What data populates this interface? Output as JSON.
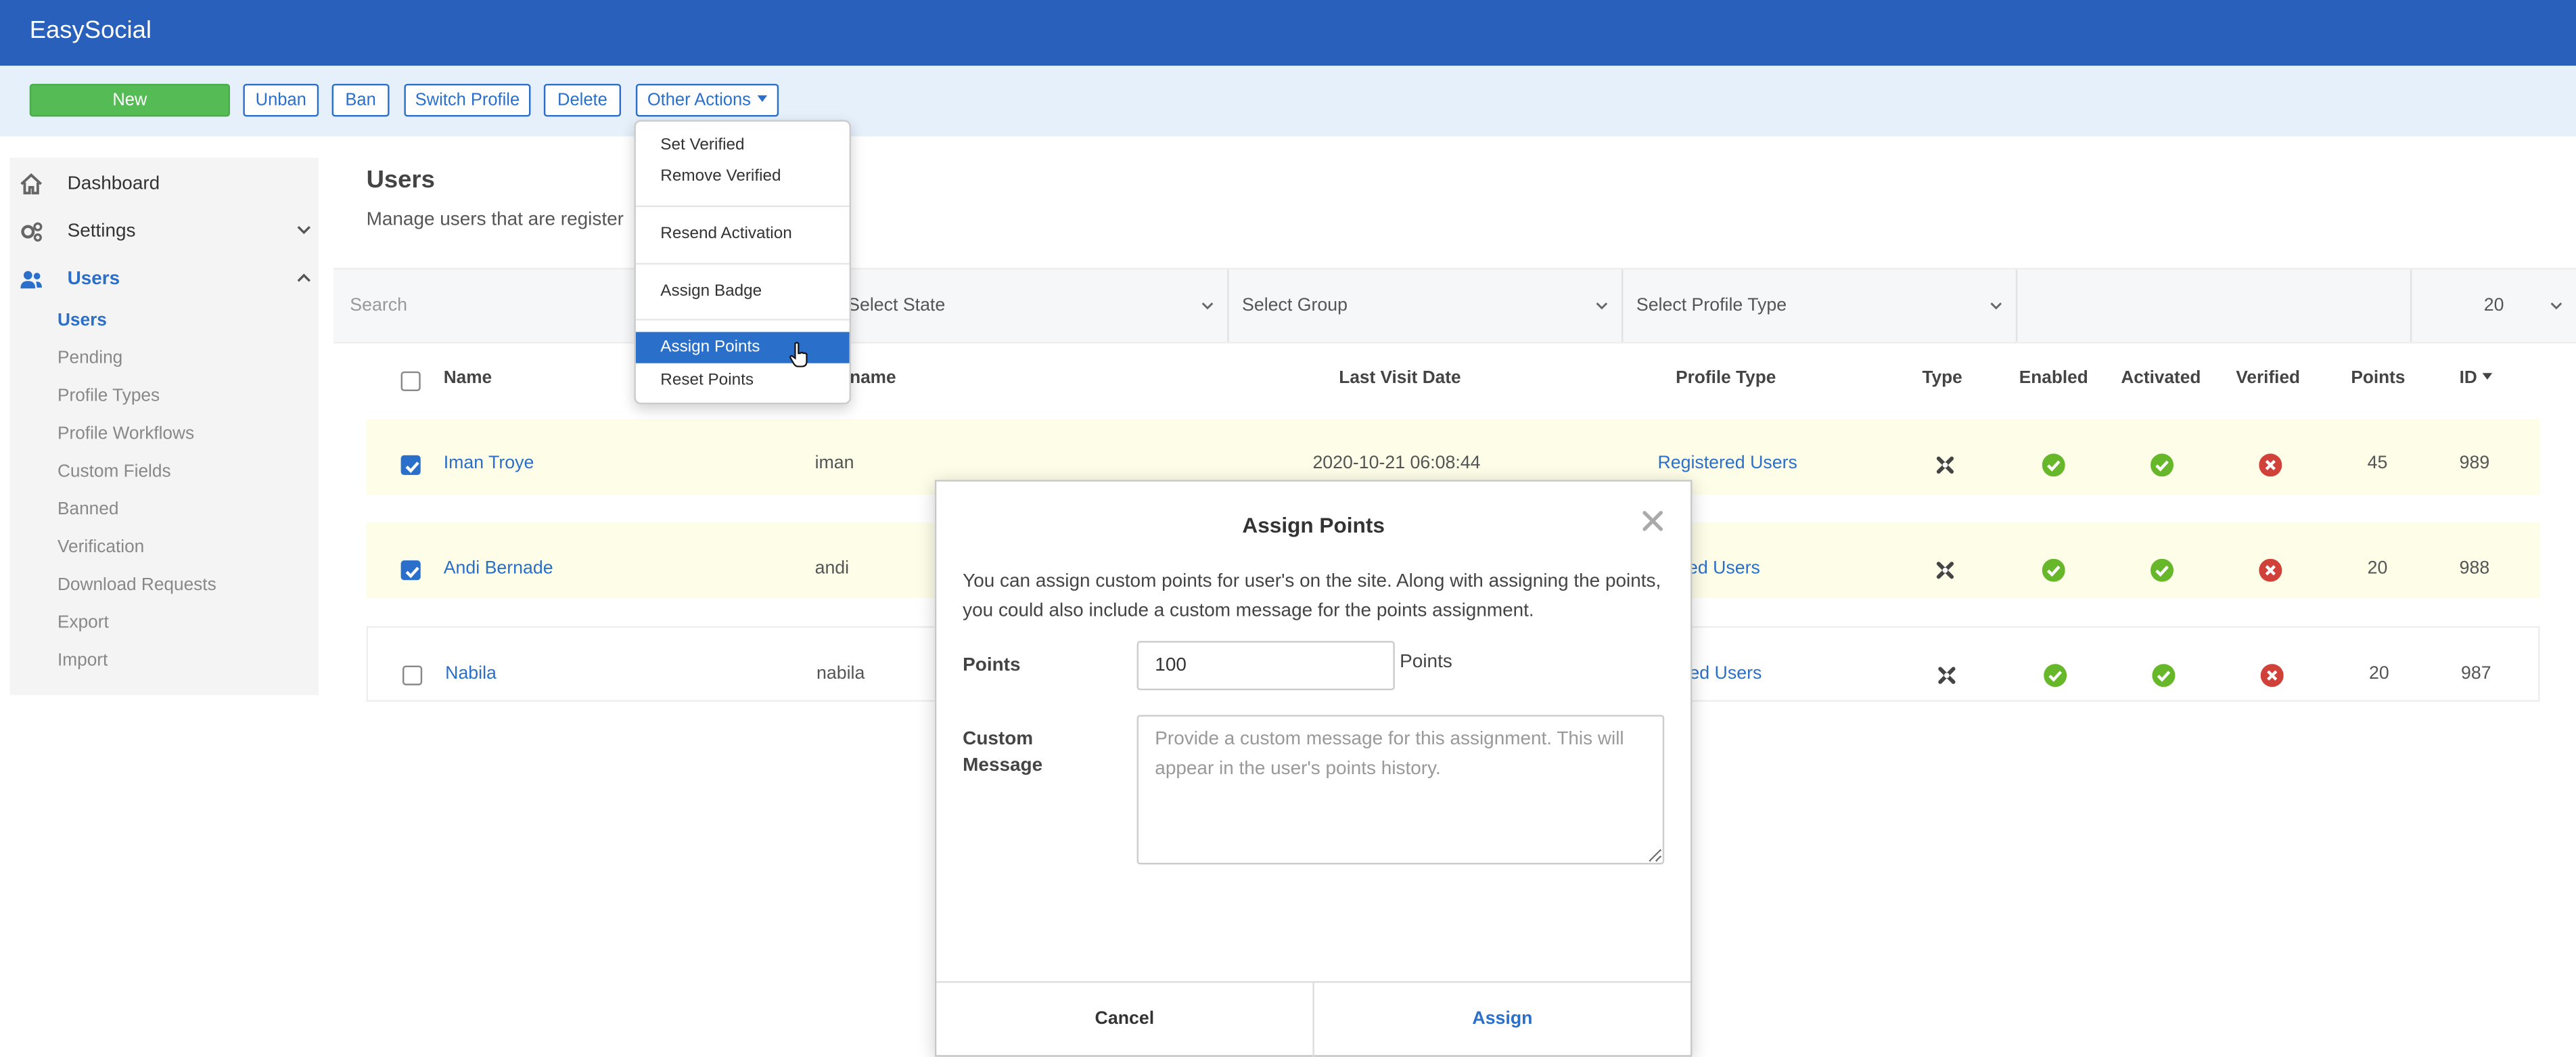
{
  "app": {
    "brand": "EasySocial"
  },
  "toolbar": {
    "new_label": "New",
    "unban_label": "Unban",
    "ban_label": "Ban",
    "switch_profile_label": "Switch Profile",
    "delete_label": "Delete",
    "other_actions_label": "Other Actions"
  },
  "sidebar": {
    "dashboard": "Dashboard",
    "settings": "Settings",
    "users": "Users",
    "sub_items": [
      "Users",
      "Pending",
      "Profile Types",
      "Profile Workflows",
      "Custom Fields",
      "Banned",
      "Verification",
      "Download Requests",
      "Export",
      "Import"
    ]
  },
  "page": {
    "title": "Users",
    "description": "Manage users that are register"
  },
  "filters": {
    "search_placeholder": "Search",
    "state": "Select State",
    "group": "Select Group",
    "profile_type": "Select Profile Type",
    "limit": "20"
  },
  "table": {
    "headers": {
      "name": "Name",
      "username": "rname",
      "last_visit": "Last Visit Date",
      "profile_type": "Profile Type",
      "type": "Type",
      "enabled": "Enabled",
      "activated": "Activated",
      "verified": "Verified",
      "points": "Points",
      "id": "ID"
    },
    "rows": [
      {
        "name": "Iman Troye",
        "username": "iman",
        "last_visit": "2020-10-21 06:08:44",
        "profile_type": "Registered Users",
        "points": "45",
        "id": "989",
        "checked": true,
        "enabled": true,
        "activated": true,
        "verified": false
      },
      {
        "name": "Andi Bernade",
        "username": "andi",
        "last_visit": "",
        "profile_type": "stered Users",
        "points": "20",
        "id": "988",
        "checked": true,
        "enabled": true,
        "activated": true,
        "verified": false
      },
      {
        "name": "Nabila",
        "username": "nabila",
        "last_visit": "",
        "profile_type": "stered Users",
        "points": "20",
        "id": "987",
        "checked": false,
        "enabled": true,
        "activated": true,
        "verified": false
      }
    ]
  },
  "menu": {
    "items": [
      "Set Verified",
      "Remove Verified",
      "Resend Activation",
      "Assign Badge",
      "Assign Points",
      "Reset Points"
    ],
    "highlighted": "Assign Points"
  },
  "modal": {
    "title": "Assign Points",
    "description": "You can assign custom points for user's on the site. Along with assigning the points, you could also include a custom message for the points assignment.",
    "points_label": "Points",
    "points_value": "100",
    "points_suffix": "Points",
    "message_label": "Custom Message",
    "message_placeholder": "Provide a custom message for this assignment. This will appear in the user's points history.",
    "cancel_label": "Cancel",
    "assign_label": "Assign"
  },
  "colors": {
    "header": "#2860bb",
    "accent": "#2a6fc9",
    "success": "#66b82a",
    "danger": "#d0413a",
    "new_button": "#55bb55"
  },
  "icons": {
    "dashboard": "home-icon",
    "settings": "cogs-icon",
    "users": "users-icon",
    "type": "joomla-icon",
    "close": "close-icon"
  }
}
